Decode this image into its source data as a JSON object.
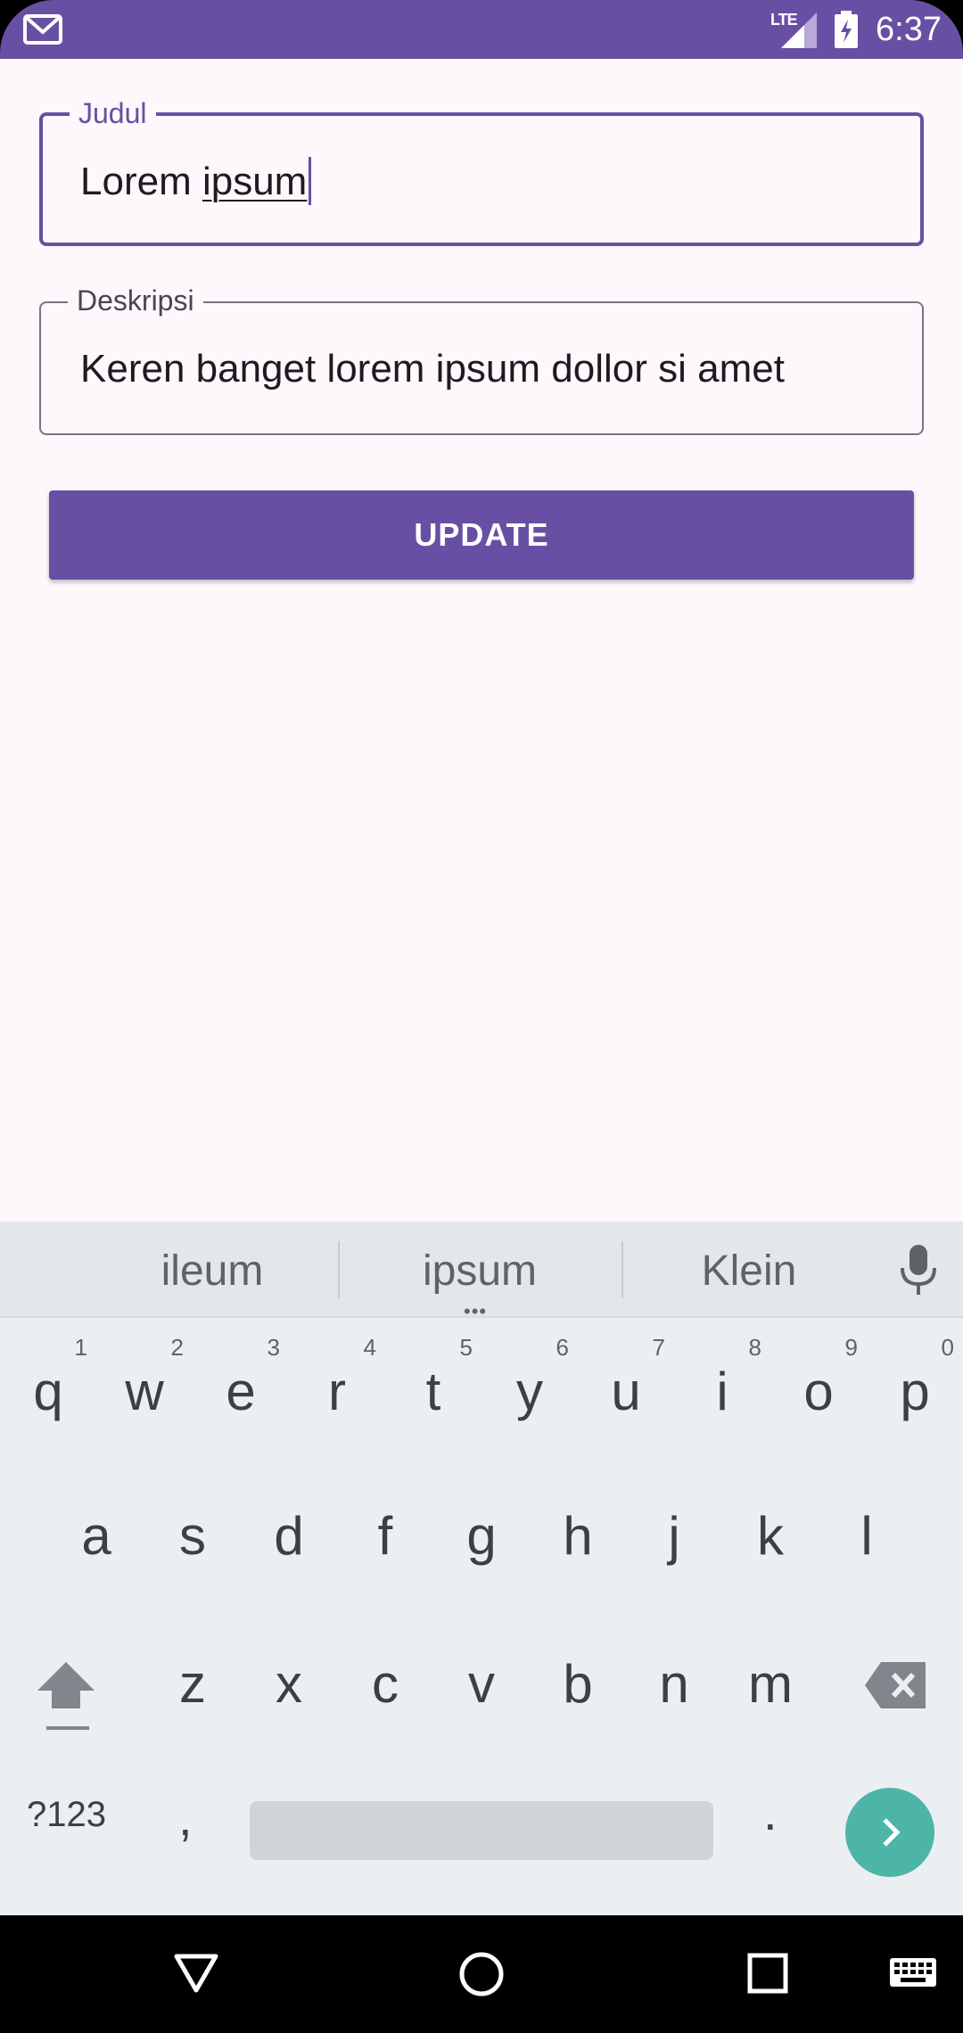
{
  "status_bar": {
    "network": "LTE",
    "time": "6:37",
    "icons": [
      "gmail-icon",
      "signal-icon",
      "battery-charging-icon"
    ],
    "background_color": "#6750a4"
  },
  "form": {
    "title_field": {
      "label": "Judul",
      "value_prefix": "Lorem ",
      "value_underlined": "ipsum",
      "focused": true
    },
    "description_field": {
      "label": "Deskripsi",
      "value": "Keren banget lorem ipsum dollor si amet"
    },
    "update_button": {
      "label": "UPDATE"
    },
    "accent_color": "#6750a4",
    "background_color": "#fef7fc"
  },
  "keyboard": {
    "suggestions": [
      "ileum",
      "ipsum",
      "Klein"
    ],
    "row1": [
      {
        "key": "q",
        "hint": "1"
      },
      {
        "key": "w",
        "hint": "2"
      },
      {
        "key": "e",
        "hint": "3"
      },
      {
        "key": "r",
        "hint": "4"
      },
      {
        "key": "t",
        "hint": "5"
      },
      {
        "key": "y",
        "hint": "6"
      },
      {
        "key": "u",
        "hint": "7"
      },
      {
        "key": "i",
        "hint": "8"
      },
      {
        "key": "o",
        "hint": "9"
      },
      {
        "key": "p",
        "hint": "0"
      }
    ],
    "row2": [
      "a",
      "s",
      "d",
      "f",
      "g",
      "h",
      "j",
      "k",
      "l"
    ],
    "row3": [
      "z",
      "x",
      "c",
      "v",
      "b",
      "n",
      "m"
    ],
    "symbols_label": "?123",
    "comma_label": ",",
    "period_label": ".",
    "go_color": "#4cb5a8"
  },
  "nav_bar": {
    "buttons": [
      "back-icon",
      "home-icon",
      "recents-icon",
      "keyboard-switch-icon"
    ]
  }
}
